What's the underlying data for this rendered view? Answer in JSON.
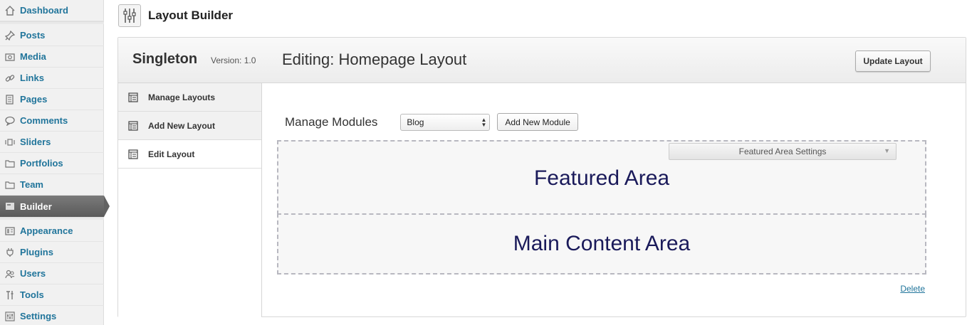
{
  "sidebar": {
    "items": [
      {
        "label": "Dashboard",
        "icon": "dashboard-icon"
      },
      {
        "label": "Posts",
        "icon": "pushpin-icon"
      },
      {
        "label": "Media",
        "icon": "media-icon"
      },
      {
        "label": "Links",
        "icon": "link-icon"
      },
      {
        "label": "Pages",
        "icon": "pages-icon"
      },
      {
        "label": "Comments",
        "icon": "comment-icon"
      },
      {
        "label": "Sliders",
        "icon": "slider-icon"
      },
      {
        "label": "Portfolios",
        "icon": "folder-icon"
      },
      {
        "label": "Team",
        "icon": "folder-icon"
      },
      {
        "label": "Builder",
        "icon": "builder-icon"
      },
      {
        "label": "Appearance",
        "icon": "appearance-icon"
      },
      {
        "label": "Plugins",
        "icon": "plugin-icon"
      },
      {
        "label": "Users",
        "icon": "users-icon"
      },
      {
        "label": "Tools",
        "icon": "tools-icon"
      },
      {
        "label": "Settings",
        "icon": "settings-icon"
      }
    ],
    "active": "Builder"
  },
  "header": {
    "title": "Layout Builder",
    "icon": "sliders-icon"
  },
  "panel": {
    "theme_name": "Singleton",
    "version": "Version: 1.0",
    "editing_title": "Editing: Homepage Layout",
    "update_button": "Update Layout"
  },
  "left_nav": {
    "items": [
      {
        "label": "Manage Layouts",
        "icon": "list-icon"
      },
      {
        "label": "Add New Layout",
        "icon": "list-icon"
      },
      {
        "label": "Edit Layout",
        "icon": "list-icon"
      }
    ],
    "current": "Edit Layout"
  },
  "content": {
    "manage_label": "Manage Modules",
    "module_select_value": "Blog",
    "add_module_button": "Add New Module",
    "featured_settings": "Featured Area Settings",
    "featured_area": "Featured Area",
    "main_area": "Main Content Area",
    "delete_link": "Delete"
  },
  "colors": {
    "link_blue": "#21759b",
    "area_title": "#1a1a5a",
    "active_menu": "#626262"
  }
}
